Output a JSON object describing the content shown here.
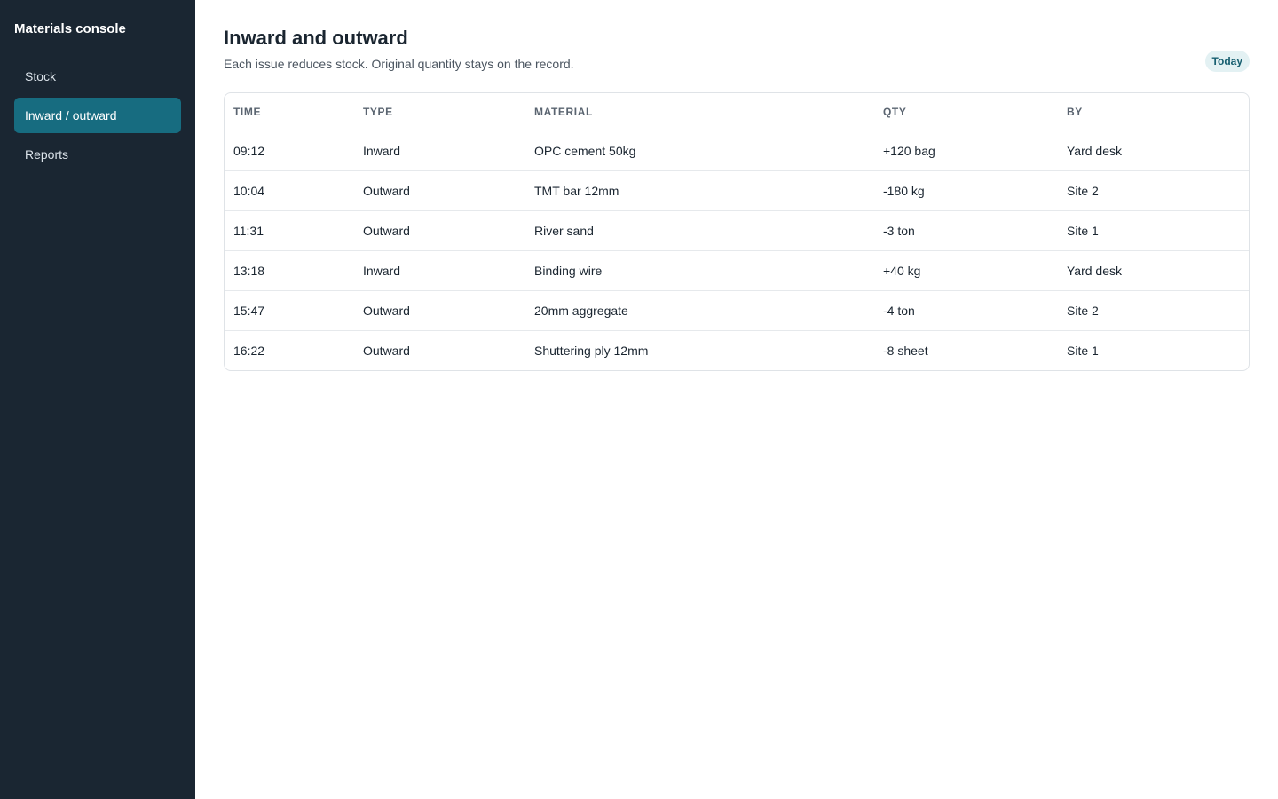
{
  "sidebar": {
    "brand": "Materials console",
    "items": [
      {
        "label": "Stock",
        "active": false
      },
      {
        "label": "Inward / outward",
        "active": true
      },
      {
        "label": "Reports",
        "active": false
      }
    ]
  },
  "header": {
    "title": "Inward and outward",
    "subtitle": "Each issue reduces stock. Original quantity stays on the record.",
    "badge": "Today"
  },
  "table": {
    "columns": [
      "TIME",
      "TYPE",
      "MATERIAL",
      "QTY",
      "BY"
    ],
    "rows": [
      {
        "time": "09:12",
        "type": "Inward",
        "material": "OPC cement 50kg",
        "qty": "+120 bag",
        "by": "Yard desk"
      },
      {
        "time": "10:04",
        "type": "Outward",
        "material": "TMT bar 12mm",
        "qty": "-180 kg",
        "by": "Site 2"
      },
      {
        "time": "11:31",
        "type": "Outward",
        "material": "River sand",
        "qty": "-3 ton",
        "by": "Site 1"
      },
      {
        "time": "13:18",
        "type": "Inward",
        "material": "Binding wire",
        "qty": "+40 kg",
        "by": "Yard desk"
      },
      {
        "time": "15:47",
        "type": "Outward",
        "material": "20mm aggregate",
        "qty": "-4 ton",
        "by": "Site 2"
      },
      {
        "time": "16:22",
        "type": "Outward",
        "material": "Shuttering ply 12mm",
        "qty": "-8 sheet",
        "by": "Site 1"
      }
    ]
  },
  "colors": {
    "sidebar_bg": "#1a2632",
    "accent": "#176c80",
    "badge_bg": "#e3f1f3",
    "badge_text": "#175f70"
  }
}
